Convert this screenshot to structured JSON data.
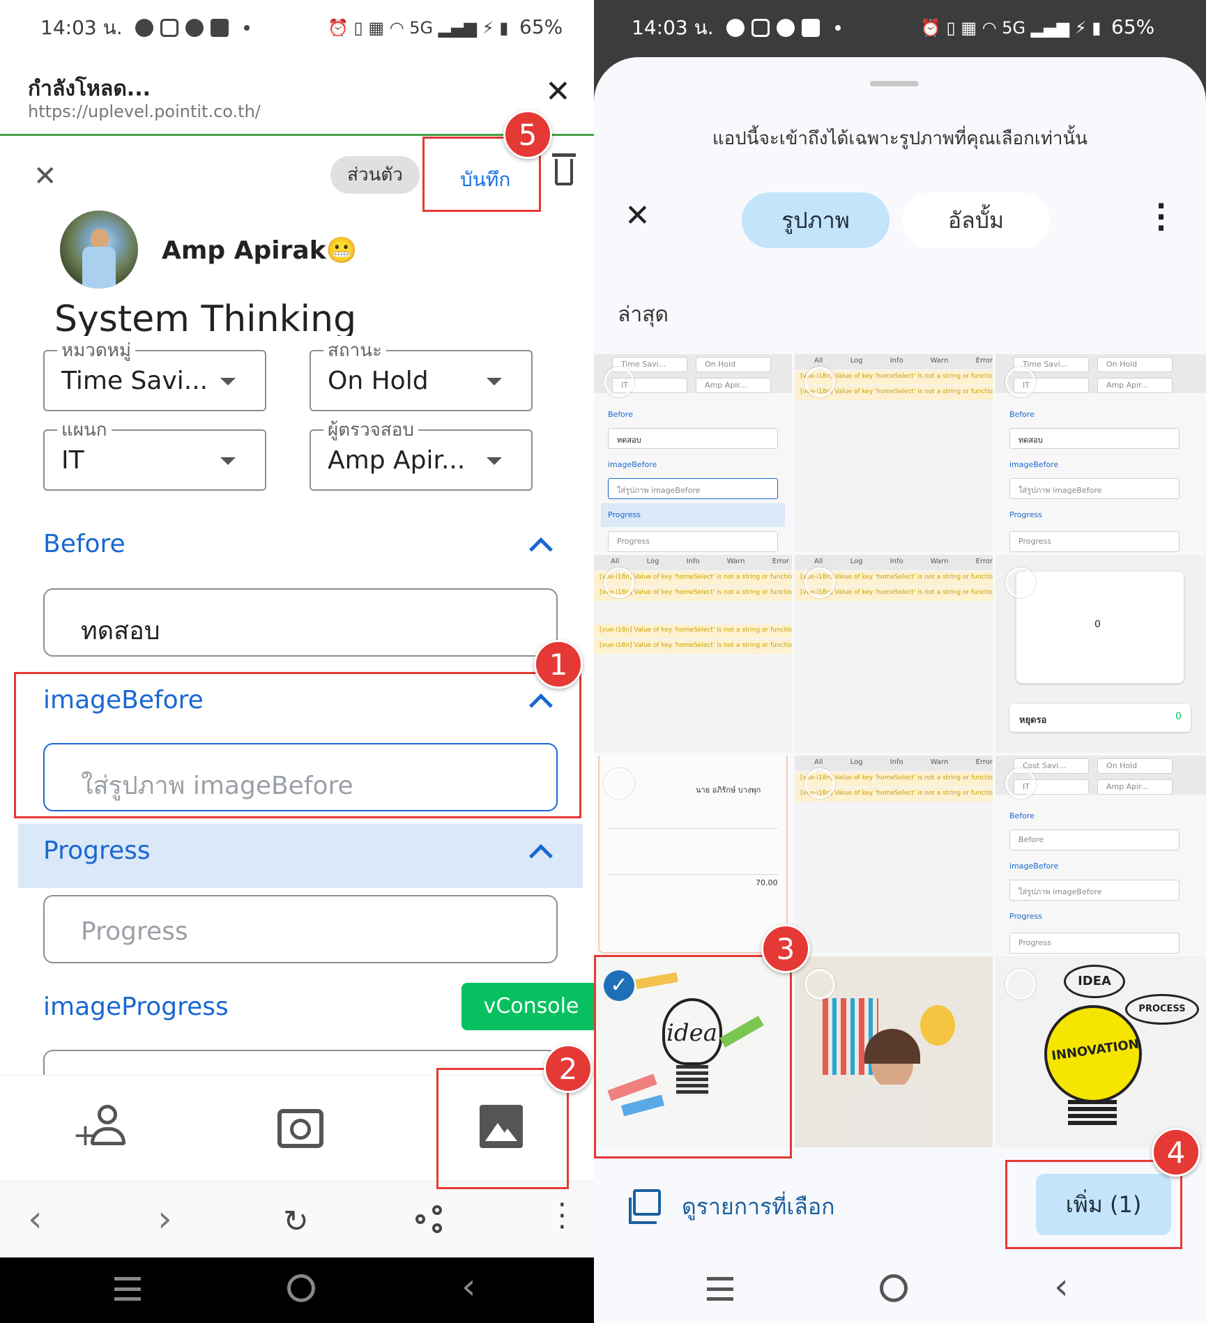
{
  "status": {
    "time": "14:03 น.",
    "network": "5G",
    "battery": "65%"
  },
  "browser": {
    "title": "กำลังโหลด...",
    "url": "https://uplevel.pointit.co.th/"
  },
  "form": {
    "privacy_label": "ส่วนตัว",
    "save_label": "บันทึก",
    "user_name": "Amp Apirak😬",
    "page_title": "System Thinking",
    "fields": [
      {
        "label": "หมวดหมู่",
        "value": "Time Savi..."
      },
      {
        "label": "สถานะ",
        "value": "On Hold"
      },
      {
        "label": "แผนก",
        "value": "IT"
      },
      {
        "label": "ผู้ตรวจสอบ",
        "value": "Amp Apir..."
      }
    ],
    "before_title": "Before",
    "before_value": "ทดสอบ",
    "image_before_title": "imageBefore",
    "image_before_placeholder": "ใส่รูปภาพ imageBefore",
    "progress_title": "Progress",
    "progress_placeholder": "Progress",
    "image_progress_title": "imageProgress",
    "vconsole_label": "vConsole"
  },
  "annotations": [
    "1",
    "2",
    "3",
    "4",
    "5"
  ],
  "picker": {
    "notice": "แอปนี้จะเข้าถึงได้เฉพาะรูปภาพที่คุณเลือกเท่านั้น",
    "tab_photos": "รูปภาพ",
    "tab_albums": "อัลบั้ม",
    "section_recent": "ล่าสุด",
    "view_selected": "ดูรายการที่เลือก",
    "add_button": "เพิ่ม (1)",
    "thumb_texts": {
      "time_savi": "Time Savi...",
      "on_hold": "On Hold",
      "it": "IT",
      "amp_apir": "Amp Apir...",
      "before": "Before",
      "test": "ทดสอบ",
      "image_before": "imageBefore",
      "image_before_ph": "ใส่รูปภาพ imageBefore",
      "progress": "Progress",
      "cost_savi": "Cost Savi...",
      "log_tabs": [
        "All",
        "Log",
        "Info",
        "Warn",
        "Error"
      ],
      "log_line": "[vue-i18n] Value of key 'homeSelect' is not a string or function !",
      "dash_zero": "0",
      "dash_label": "หยุดรอ",
      "idea": "idea",
      "idea2": "IDEA",
      "innovation": "INNOVATION",
      "process": "PROCESS",
      "receipt_amount": "70.00",
      "receipt_name": "นาย อภิรักษ์ บางพุก"
    }
  }
}
